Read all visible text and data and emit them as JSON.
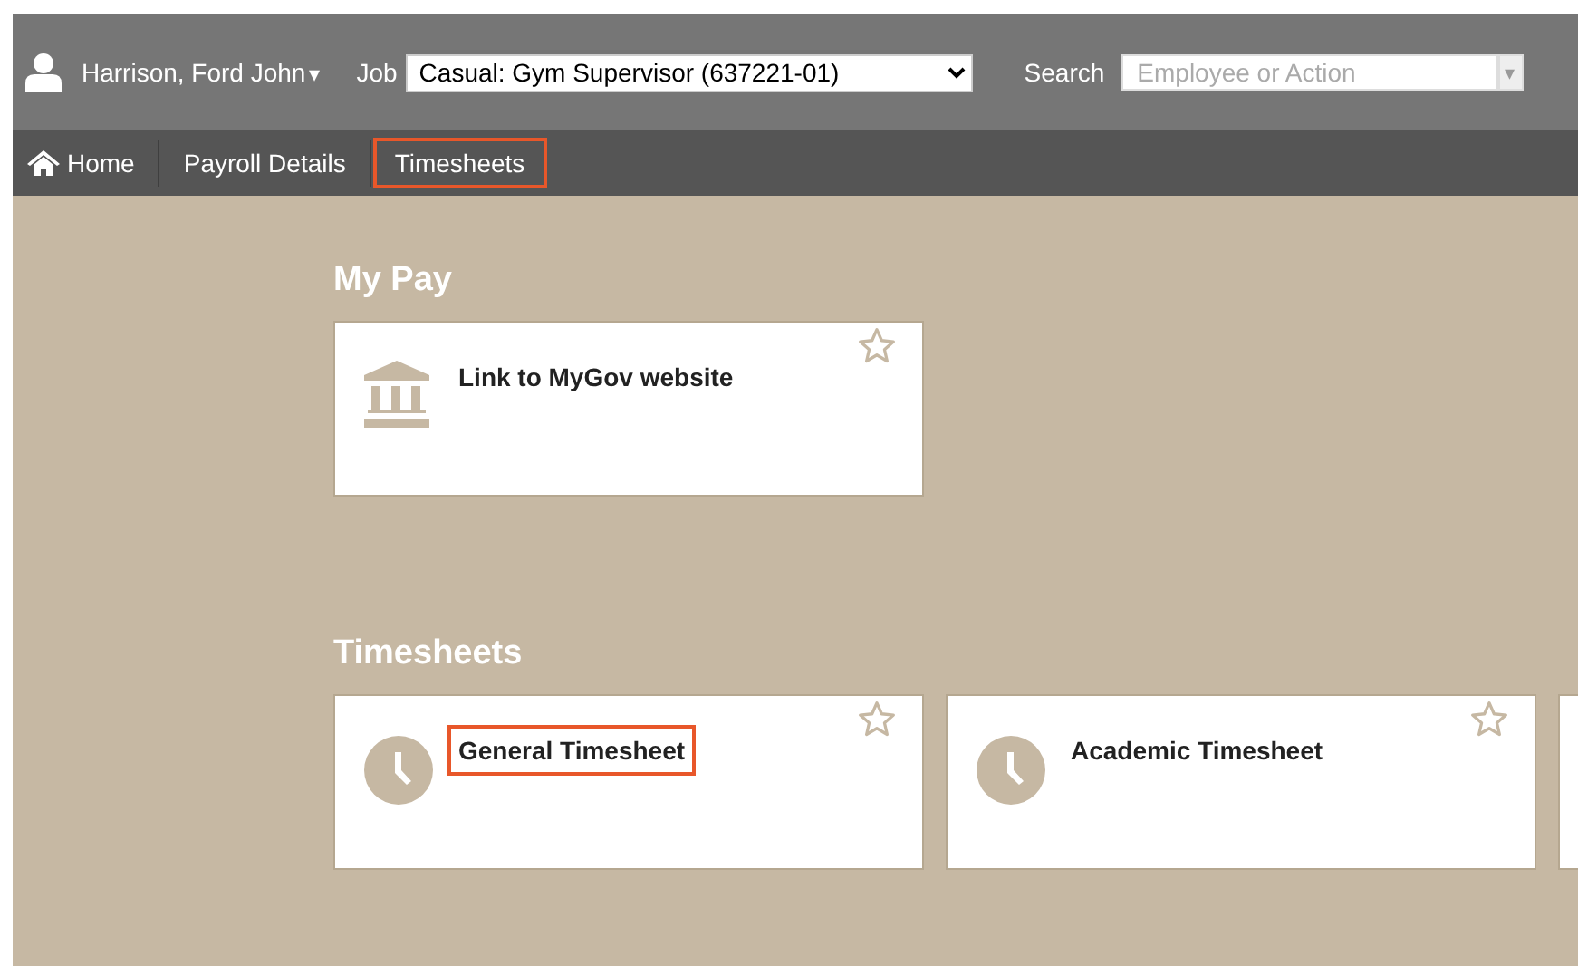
{
  "header": {
    "user_name": "Harrison, Ford John",
    "user_caret": "▾",
    "job_label": "Job",
    "job_value": "Casual: Gym Supervisor (637221-01)",
    "search_label": "Search",
    "search": {
      "placeholder": "Employee or Action"
    },
    "search_caret": "▾"
  },
  "nav": [
    {
      "label": "Home",
      "kind": "home",
      "highlighted": false
    },
    {
      "label": "Payroll Details",
      "kind": "plain",
      "highlighted": false
    },
    {
      "label": "Timesheets",
      "kind": "plain",
      "highlighted": true
    }
  ],
  "sections": [
    {
      "title": "My Pay",
      "tiles": [
        {
          "title": "Link to MyGov website",
          "kind": "bank",
          "highlighted": false
        }
      ]
    },
    {
      "title": "Timesheets",
      "tiles": [
        {
          "title": "General Timesheet",
          "kind": "clock",
          "highlighted": true
        },
        {
          "title": "Academic Timesheet",
          "kind": "clock",
          "highlighted": false
        },
        {
          "kind": "clipped"
        }
      ]
    }
  ]
}
